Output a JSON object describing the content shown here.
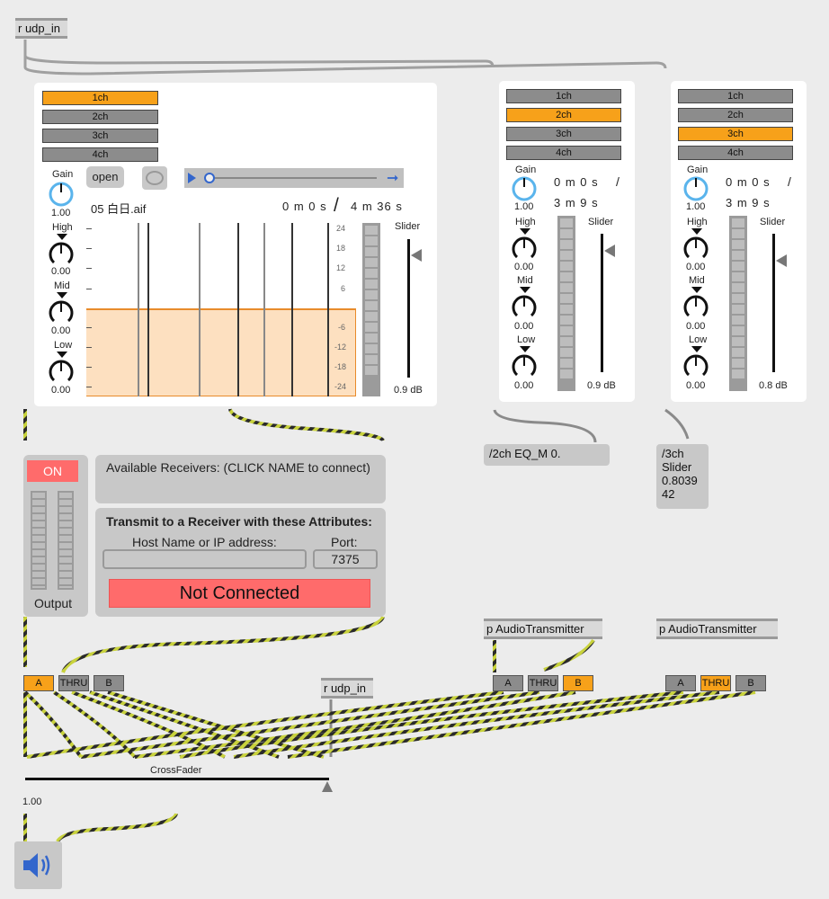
{
  "top_receive": {
    "label": "r udp_in"
  },
  "mid_receive": {
    "label": "r udp_in"
  },
  "player1": {
    "channels": [
      "1ch",
      "2ch",
      "3ch",
      "4ch"
    ],
    "active_channel": "1ch",
    "gain_label": "Gain",
    "gain_value": "1.00",
    "high_label": "High",
    "high_value": "0.00",
    "mid_label": "Mid",
    "mid_value": "0.00",
    "low_label": "Low",
    "low_value": "0.00",
    "open_label": "open",
    "filename": "05 白日.aif",
    "time_current": "0 m 0 s",
    "time_sep": "/",
    "time_total": "4 m 36 s",
    "slider_label": "Slider",
    "slider_value": "0.9 dB",
    "scale_ticks": [
      "24",
      "18",
      "12",
      "6",
      "-6",
      "-12",
      "-18",
      "-24"
    ]
  },
  "player2": {
    "channels": [
      "1ch",
      "2ch",
      "3ch",
      "4ch"
    ],
    "active_channel": "2ch",
    "gain_label": "Gain",
    "gain_value": "1.00",
    "high_label": "High",
    "high_value": "0.00",
    "mid_label": "Mid",
    "mid_value": "0.00",
    "low_label": "Low",
    "low_value": "0.00",
    "time_current": "0 m 0 s",
    "time_sep": "/",
    "time_total": "3 m 9 s",
    "slider_label": "Slider",
    "slider_value": "0.9 dB"
  },
  "player3": {
    "channels": [
      "1ch",
      "2ch",
      "3ch",
      "4ch"
    ],
    "active_channel": "3ch",
    "gain_label": "Gain",
    "gain_value": "1.00",
    "high_label": "High",
    "high_value": "0.00",
    "mid_label": "Mid",
    "mid_value": "0.00",
    "low_label": "Low",
    "low_value": "0.00",
    "time_current": "0 m 0 s",
    "time_sep": "/",
    "time_total": "3 m 9 s",
    "slider_label": "Slider",
    "slider_value": "0.8 dB"
  },
  "msg2": {
    "text": "/2ch EQ_M 0."
  },
  "msg3": {
    "line1": "/3ch",
    "line2": "Slider",
    "line3": "0.8039",
    "line4": "42"
  },
  "output": {
    "on_label": "ON",
    "label": "Output"
  },
  "receivers": {
    "title": "Available Receivers: (CLICK NAME to connect)"
  },
  "transmit": {
    "title": "Transmit to a Receiver with these Attributes:",
    "host_label": "Host Name or IP address:",
    "host_value": "",
    "port_label": "Port:",
    "port_value": "7375",
    "status": "Not Connected"
  },
  "transmitter2": {
    "label": "p AudioTransmitter"
  },
  "transmitter3": {
    "label": "p AudioTransmitter"
  },
  "switch1": {
    "a": "A",
    "thru": "THRU",
    "b": "B",
    "active": "A"
  },
  "switch2": {
    "a": "A",
    "thru": "THRU",
    "b": "B",
    "active": "B"
  },
  "switch3": {
    "a": "A",
    "thru": "THRU",
    "b": "B",
    "active": "THRU"
  },
  "crossfader": {
    "label": "CrossFader",
    "value": "1.00"
  },
  "colors": {
    "accent": "#f7a11a",
    "status_red": "#ff6b6b",
    "wire": "#c8d23c"
  }
}
